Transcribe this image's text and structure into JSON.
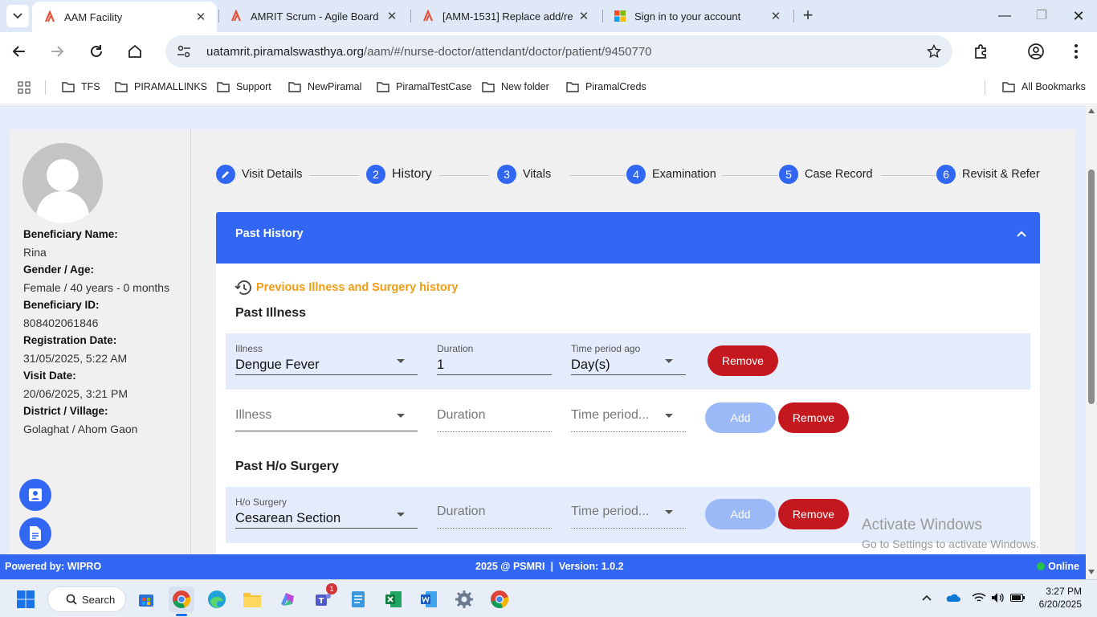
{
  "browser": {
    "tabs": [
      {
        "title": "AAM Facility",
        "active": true
      },
      {
        "title": "AMRIT Scrum - Agile Board",
        "active": false
      },
      {
        "title": "[AMM-1531] Replace add/re",
        "active": false
      },
      {
        "title": "Sign in to your account",
        "active": false
      }
    ],
    "url_host": "uatamrit.piramalswasthya.org",
    "url_path": "/aam/#/nurse-doctor/attendant/doctor/patient/9450770",
    "bookmarks": [
      "TFS",
      "PIRAMALLINKS",
      "Support",
      "NewPiramal",
      "PiramalTestCase",
      "New folder",
      "PiramalCreds"
    ],
    "all_bookmarks": "All Bookmarks"
  },
  "beneficiary": {
    "name_label": "Beneficiary Name:",
    "name": "Rina",
    "gender_label": "Gender / Age:",
    "gender_age": "Female / 40 years - 0 months",
    "id_label": "Beneficiary ID:",
    "id": "808402061846",
    "reg_label": "Registration Date:",
    "reg_date": "31/05/2025, 5:22 AM",
    "visit_label": "Visit Date:",
    "visit_date": "20/06/2025, 3:21 PM",
    "district_label": "District / Village:",
    "district": "Golaghat / Ahom Gaon"
  },
  "stepper": [
    {
      "num": "",
      "label": "Visit Details"
    },
    {
      "num": "2",
      "label": "History"
    },
    {
      "num": "3",
      "label": "Vitals"
    },
    {
      "num": "4",
      "label": "Examination"
    },
    {
      "num": "5",
      "label": "Case Record"
    },
    {
      "num": "6",
      "label": "Revisit & Refer"
    }
  ],
  "accordion": {
    "title": "Past History",
    "prev_history_link": "Previous Illness and Surgery history",
    "past_illness_title": "Past Illness",
    "past_surgery_title": "Past H/o Surgery",
    "illness_rows": [
      {
        "illness_label": "Illness",
        "illness": "Dengue Fever",
        "duration_label": "Duration",
        "duration": "1",
        "period_label": "Time period ago",
        "period": "Day(s)",
        "remove": "Remove"
      },
      {
        "illness_placeholder": "Illness",
        "duration_placeholder": "Duration",
        "period_placeholder": "Time period...",
        "add": "Add",
        "remove": "Remove"
      }
    ],
    "surgery_rows": [
      {
        "surgery_label": "H/o Surgery",
        "surgery": "Cesarean Section",
        "duration_placeholder": "Duration",
        "period_placeholder": "Time period...",
        "add": "Add",
        "remove": "Remove"
      }
    ]
  },
  "watermark": {
    "line1": "Activate Windows",
    "line2": "Go to Settings to activate Windows."
  },
  "footer": {
    "powered": "Powered by: WIPRO",
    "center": "2025 @ PSMRI  |  Version: 1.0.2",
    "status": "Online"
  },
  "taskbar": {
    "search": "Search",
    "teams_badge": "1",
    "time": "3:27 PM",
    "date": "6/20/2025"
  },
  "colors": {
    "primary": "#3167f3",
    "remove": "#c4181e",
    "add_disabled": "#9bb8f7",
    "accent_orange": "#f39c12",
    "row_bg": "#e4ecfb"
  }
}
